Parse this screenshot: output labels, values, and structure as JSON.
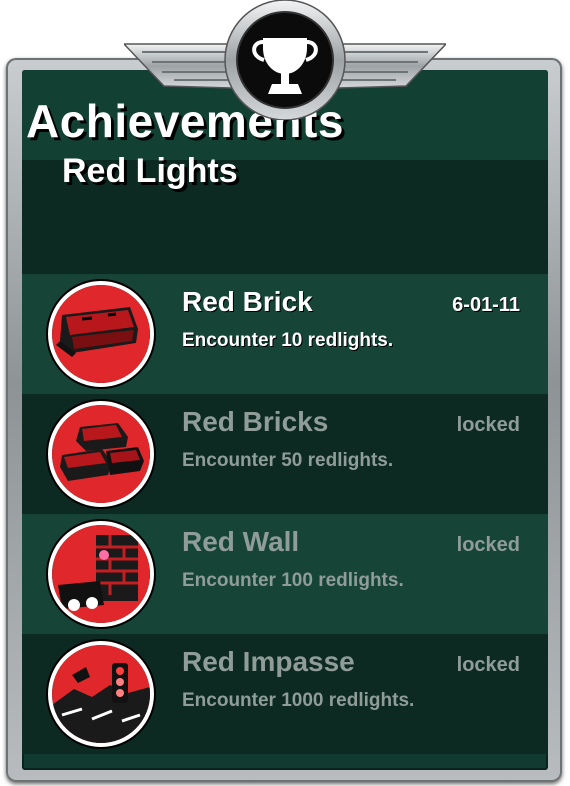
{
  "header": {
    "title": "Achievements",
    "subtitle": "Red Lights",
    "emblem_icon": "trophy-icon"
  },
  "colors": {
    "panel": "#113b30",
    "row_light": "#164538",
    "row_dark": "#0c2a22",
    "badge_red": "#e0282c",
    "locked_text": "#8f9c98",
    "unlocked_text": "#ffffff"
  },
  "achievements": [
    {
      "name": "Red Brick",
      "description": "Encounter 10 redlights.",
      "status": "6-01-11",
      "unlocked": true,
      "icon": "single-brick-icon"
    },
    {
      "name": "Red Bricks",
      "description": "Encounter 50 redlights.",
      "status": "locked",
      "unlocked": false,
      "icon": "brick-pile-icon"
    },
    {
      "name": "Red Wall",
      "description": "Encounter 100 redlights.",
      "status": "locked",
      "unlocked": false,
      "icon": "brick-wall-icon"
    },
    {
      "name": "Red Impasse",
      "description": "Encounter 1000 redlights.",
      "status": "locked",
      "unlocked": false,
      "icon": "traffic-impasse-icon"
    }
  ]
}
